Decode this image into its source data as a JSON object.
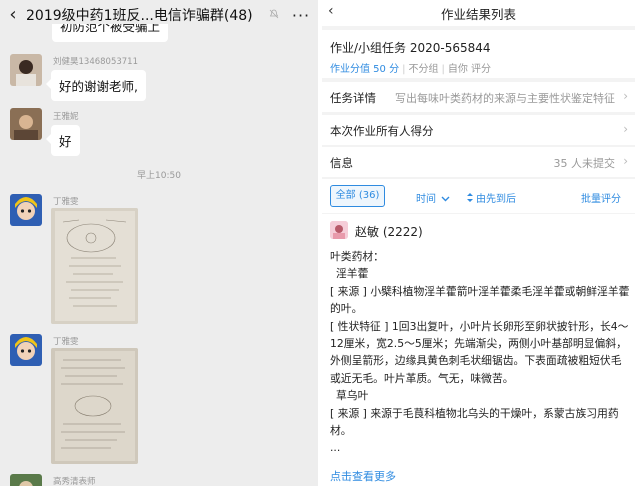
{
  "chat": {
    "back_glyph": "‹",
    "title": "2019级中药1班反...电信诈骗群(48)",
    "mute_glyph": "🔕",
    "more_glyph": "···",
    "partial_bubble": "初防范个被受骗上",
    "messages": [
      {
        "sender": "刘健昊13468053711",
        "text": "好的谢谢老师,"
      },
      {
        "sender": "王雅妮",
        "text": "好"
      }
    ],
    "timestamp": "早上10:50",
    "photo_senders": [
      "丁雅雯",
      "丁雅雯",
      "高秀清表师"
    ]
  },
  "result": {
    "back_glyph": "‹",
    "title": "作业结果列表",
    "task_name": "作业/小组任务 2020-565844",
    "score_label": "作业分值 50 分",
    "group_label": "不分组",
    "self_eval_label": "自你 评分",
    "rows": [
      {
        "label": "任务详情",
        "value": "写出每味叶类药材的来源与主要性状鉴定特征"
      },
      {
        "label": "本次作业所有人得分",
        "value": ""
      },
      {
        "label": "信息",
        "value": "35 人未提交"
      }
    ],
    "chevron_glyph": "›",
    "toolbar": {
      "all": "全部 (36)",
      "time": "时间",
      "order": "由先到后",
      "batch": "批量评分"
    },
    "student": "赵敏 (2222)",
    "answer_lines": [
      "叶类药材：",
      "  淫羊藿",
      "   [ 来源 ] 小檗科植物淫羊藿箭叶淫羊藿柔毛淫羊藿或朝鲜淫羊藿的叶。",
      "   [ 性状特征 ] 1回3出复叶，小叶片长卵形至卵状披针形，长4～12厘米，宽2.5～5厘米；先端渐尖，两侧小叶基部明显偏斜，外侧呈箭形，边缘具黄色刺毛状细锯齿。下表面疏被粗短伏毛或近无毛。叶片革质。气无，味微苦。",
      "  草乌叶",
      "   [ 来源 ] 来源于毛茛科植物北乌头的干燥叶，系蒙古族习用药材。",
      "  ..."
    ],
    "more_link": "点击查看更多"
  },
  "colors": {
    "accent": "#2f8be0",
    "chat_bg": "#ededed"
  }
}
